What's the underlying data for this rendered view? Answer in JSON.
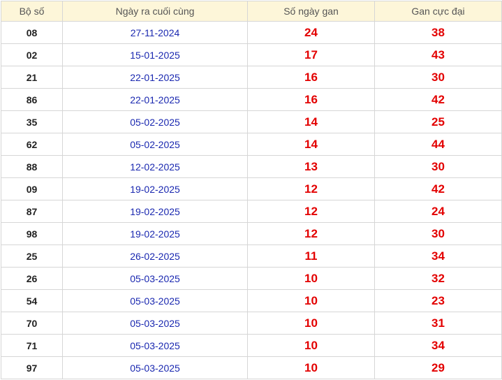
{
  "table": {
    "headers": {
      "bo_so": "Bộ số",
      "ngay_ra": "Ngày ra cuối cùng",
      "so_ngay_gan": "Số ngày gan",
      "gan_cuc_dai": "Gan cực đại"
    },
    "rows": [
      {
        "bo_so": "08",
        "ngay_ra": "27-11-2024",
        "so_ngay_gan": "24",
        "gan_cuc_dai": "38"
      },
      {
        "bo_so": "02",
        "ngay_ra": "15-01-2025",
        "so_ngay_gan": "17",
        "gan_cuc_dai": "43"
      },
      {
        "bo_so": "21",
        "ngay_ra": "22-01-2025",
        "so_ngay_gan": "16",
        "gan_cuc_dai": "30"
      },
      {
        "bo_so": "86",
        "ngay_ra": "22-01-2025",
        "so_ngay_gan": "16",
        "gan_cuc_dai": "42"
      },
      {
        "bo_so": "35",
        "ngay_ra": "05-02-2025",
        "so_ngay_gan": "14",
        "gan_cuc_dai": "25"
      },
      {
        "bo_so": "62",
        "ngay_ra": "05-02-2025",
        "so_ngay_gan": "14",
        "gan_cuc_dai": "44"
      },
      {
        "bo_so": "88",
        "ngay_ra": "12-02-2025",
        "so_ngay_gan": "13",
        "gan_cuc_dai": "30"
      },
      {
        "bo_so": "09",
        "ngay_ra": "19-02-2025",
        "so_ngay_gan": "12",
        "gan_cuc_dai": "42"
      },
      {
        "bo_so": "87",
        "ngay_ra": "19-02-2025",
        "so_ngay_gan": "12",
        "gan_cuc_dai": "24"
      },
      {
        "bo_so": "98",
        "ngay_ra": "19-02-2025",
        "so_ngay_gan": "12",
        "gan_cuc_dai": "30"
      },
      {
        "bo_so": "25",
        "ngay_ra": "26-02-2025",
        "so_ngay_gan": "11",
        "gan_cuc_dai": "34"
      },
      {
        "bo_so": "26",
        "ngay_ra": "05-03-2025",
        "so_ngay_gan": "10",
        "gan_cuc_dai": "32"
      },
      {
        "bo_so": "54",
        "ngay_ra": "05-03-2025",
        "so_ngay_gan": "10",
        "gan_cuc_dai": "23"
      },
      {
        "bo_so": "70",
        "ngay_ra": "05-03-2025",
        "so_ngay_gan": "10",
        "gan_cuc_dai": "31"
      },
      {
        "bo_so": "71",
        "ngay_ra": "05-03-2025",
        "so_ngay_gan": "10",
        "gan_cuc_dai": "34"
      },
      {
        "bo_so": "97",
        "ngay_ra": "05-03-2025",
        "so_ngay_gan": "10",
        "gan_cuc_dai": "29"
      }
    ]
  },
  "colors": {
    "header_bg": "#fdf6d9",
    "date_text": "#1a28b0",
    "number_highlight": "#e30000"
  }
}
